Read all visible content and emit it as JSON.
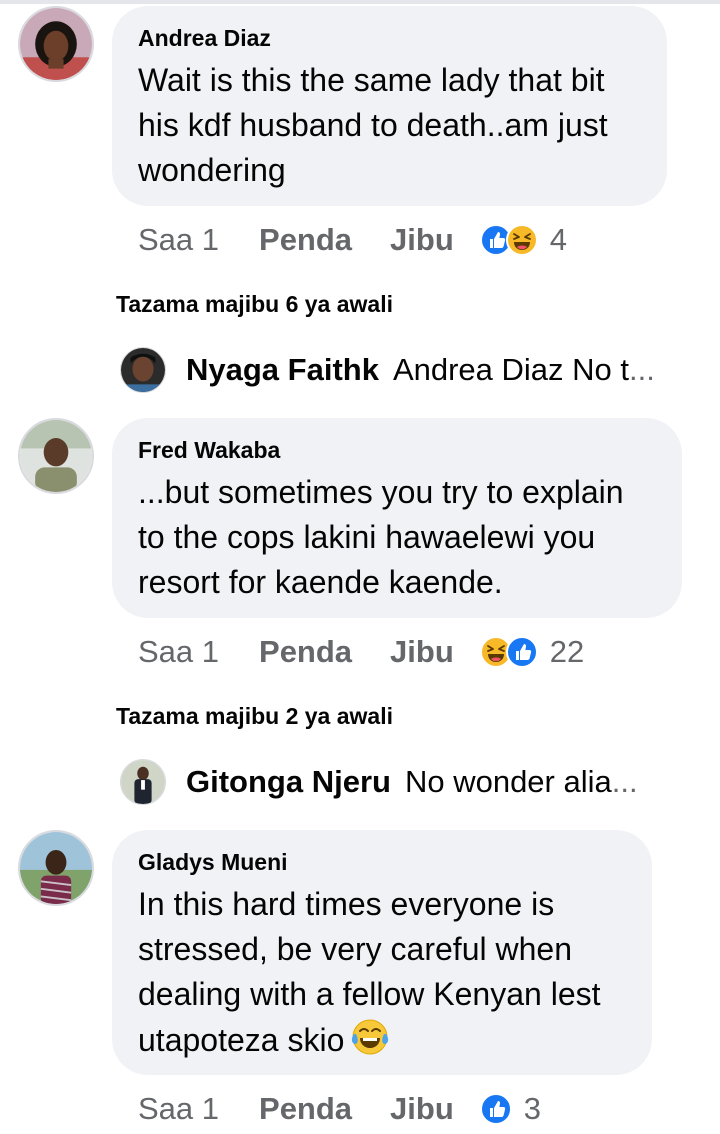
{
  "comments": [
    {
      "author": "Andrea Diaz",
      "lines": [
        "Wait is this the same lady that bit",
        "his kdf husband to death..am just",
        "wondering"
      ],
      "time": "Saa 1",
      "like_label": "Penda",
      "reply_label": "Jibu",
      "reactions": [
        "like-icon",
        "haha-icon"
      ],
      "reaction_count": "4",
      "view_replies": "Tazama majibu 6 ya awali",
      "reply_preview": {
        "name": "Nyaga Faithk",
        "text": "Andrea Diaz No t",
        "ellipsis": "..."
      }
    },
    {
      "author": "Fred Wakaba",
      "lines": [
        "...but sometimes you try to explain",
        "to the cops lakini hawaelewi you",
        "resort for kaende kaende."
      ],
      "time": "Saa 1",
      "like_label": "Penda",
      "reply_label": "Jibu",
      "reactions": [
        "haha-icon",
        "like-icon"
      ],
      "reaction_count": "22",
      "view_replies": "Tazama majibu 2 ya awali",
      "reply_preview": {
        "name": "Gitonga Njeru",
        "text": "No wonder alia",
        "ellipsis": "..."
      }
    },
    {
      "author": "Gladys Mueni",
      "lines": [
        "In this hard times everyone is",
        "stressed, be very careful when",
        "dealing with a fellow Kenyan lest",
        "utapoteza skio"
      ],
      "inline_emoji": "tears-of-joy-emoji",
      "time": "Saa 1",
      "like_label": "Penda",
      "reply_label": "Jibu",
      "reactions": [
        "like-icon"
      ],
      "reaction_count": "3"
    }
  ],
  "colors": {
    "bubble": "#f0f2f5",
    "meta_text": "#65676b",
    "like_blue": "#1877f2",
    "haha_yellow": "#f7b928"
  }
}
